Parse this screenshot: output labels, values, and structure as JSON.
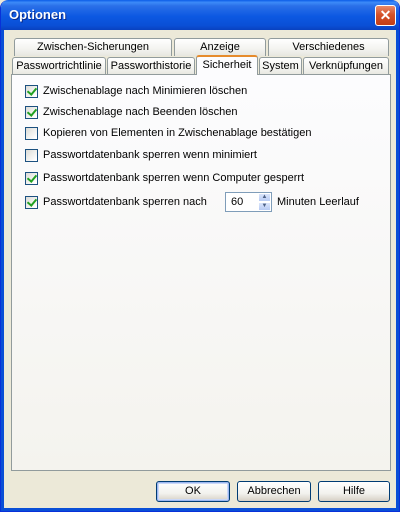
{
  "window": {
    "title": "Optionen",
    "close_label": "✕"
  },
  "tabs_row1": [
    {
      "label": "Zwischen-Sicherungen"
    },
    {
      "label": "Anzeige"
    },
    {
      "label": "Verschiedenes"
    }
  ],
  "tabs_row2": [
    {
      "label": "Passwortrichtlinie"
    },
    {
      "label": "Passworthistorie"
    },
    {
      "label": "Sicherheit",
      "active": true
    },
    {
      "label": "System"
    },
    {
      "label": "Verknüpfungen"
    }
  ],
  "options": [
    {
      "label": "Zwischenablage nach Minimieren löschen",
      "checked": true
    },
    {
      "label": "Zwischenablage nach Beenden löschen",
      "checked": true
    },
    {
      "label": "Kopieren von Elementen in Zwischenablage bestätigen",
      "checked": false
    },
    {
      "label": "Passwortdatenbank sperren wenn minimiert",
      "checked": false
    },
    {
      "label": "Passwortdatenbank sperren wenn Computer gesperrt",
      "checked": true
    },
    {
      "label": "Passwortdatenbank sperren nach",
      "checked": true
    }
  ],
  "lock_timeout": {
    "value": "60",
    "unit_label": "Minuten Leerlauf"
  },
  "buttons": {
    "ok": "OK",
    "cancel": "Abbrechen",
    "help": "Hilfe"
  }
}
